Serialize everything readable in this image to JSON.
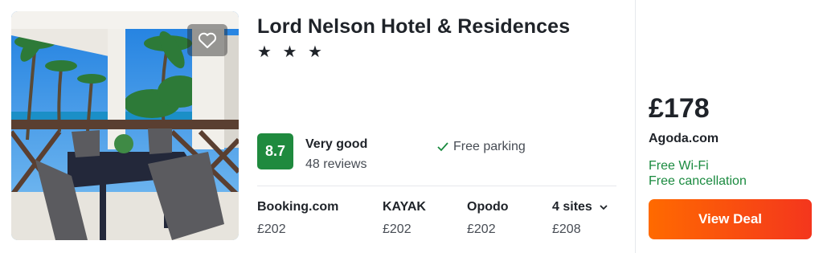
{
  "hotel": {
    "name": "Lord Nelson Hotel & Residences",
    "stars": "★ ★ ★"
  },
  "rating": {
    "score": "8.7",
    "label": "Very good",
    "reviews": "48 reviews"
  },
  "amenity": {
    "check_icon": "check-icon",
    "label": "Free parking"
  },
  "sites": [
    {
      "name": "Booking.com",
      "price": "£202"
    },
    {
      "name": "KAYAK",
      "price": "£202"
    },
    {
      "name": "Opodo",
      "price": "£202"
    },
    {
      "name": "4 sites",
      "price": "£208"
    }
  ],
  "deal": {
    "price": "£178",
    "provider": "Agoda.com",
    "perks": [
      "Free Wi-Fi",
      "Free cancellation"
    ],
    "button_label": "View Deal"
  },
  "colors": {
    "score_bg": "#1f8a3e",
    "perk_text": "#1a8a3f",
    "deal_button": "#f4501a"
  }
}
